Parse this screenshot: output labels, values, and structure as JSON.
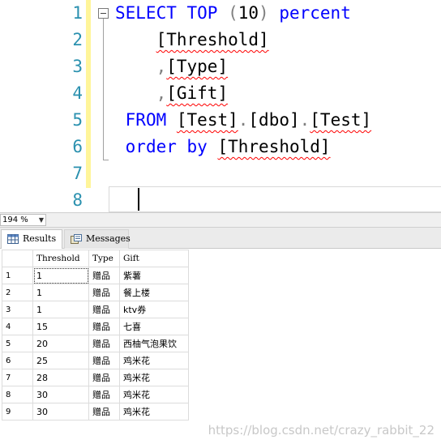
{
  "editor": {
    "line_numbers": [
      "1",
      "2",
      "3",
      "4",
      "5",
      "6",
      "7",
      "8"
    ],
    "lines": [
      [
        {
          "t": "SELECT",
          "c": "kw"
        },
        {
          "t": " ",
          "c": "tx"
        },
        {
          "t": "TOP",
          "c": "kw"
        },
        {
          "t": " (",
          "c": "gr"
        },
        {
          "t": "10",
          "c": "tx"
        },
        {
          "t": ") ",
          "c": "gr"
        },
        {
          "t": "percent",
          "c": "kw"
        }
      ],
      [
        {
          "t": "    ",
          "c": "tx"
        },
        {
          "t": "[Threshold]",
          "c": "tx sq"
        }
      ],
      [
        {
          "t": "    ",
          "c": "tx"
        },
        {
          "t": ",",
          "c": "gr"
        },
        {
          "t": "[Type]",
          "c": "tx sq"
        }
      ],
      [
        {
          "t": "    ",
          "c": "tx"
        },
        {
          "t": ",",
          "c": "gr"
        },
        {
          "t": "[Gift]",
          "c": "tx sq"
        }
      ],
      [
        {
          "t": " ",
          "c": "tx"
        },
        {
          "t": "FROM",
          "c": "kw"
        },
        {
          "t": " ",
          "c": "tx"
        },
        {
          "t": "[Test]",
          "c": "tx sq"
        },
        {
          "t": ".",
          "c": "gr"
        },
        {
          "t": "[dbo]",
          "c": "tx"
        },
        {
          "t": ".",
          "c": "gr"
        },
        {
          "t": "[Test]",
          "c": "tx sq"
        }
      ],
      [
        {
          "t": " ",
          "c": "tx"
        },
        {
          "t": "order",
          "c": "kw"
        },
        {
          "t": " ",
          "c": "tx"
        },
        {
          "t": "by",
          "c": "kw"
        },
        {
          "t": " ",
          "c": "tx"
        },
        {
          "t": "[Threshold]",
          "c": "tx sq"
        }
      ],
      [],
      []
    ]
  },
  "zoom": {
    "value": "194 %"
  },
  "tabs": [
    {
      "label": "Results",
      "icon": "grid-icon",
      "active": true
    },
    {
      "label": "Messages",
      "icon": "messages-icon",
      "active": false
    }
  ],
  "grid": {
    "columns": [
      "Threshold",
      "Type",
      "Gift"
    ],
    "rows": [
      [
        "1",
        "1",
        "赠品",
        "紫薯"
      ],
      [
        "2",
        "1",
        "赠品",
        "餐上楼"
      ],
      [
        "3",
        "1",
        "赠品",
        "ktv券"
      ],
      [
        "4",
        "15",
        "赠品",
        "七喜"
      ],
      [
        "5",
        "20",
        "赠品",
        "西柚气泡果饮"
      ],
      [
        "6",
        "25",
        "赠品",
        "鸡米花"
      ],
      [
        "7",
        "28",
        "赠品",
        "鸡米花"
      ],
      [
        "8",
        "30",
        "赠品",
        "鸡米花"
      ],
      [
        "9",
        "30",
        "赠品",
        "鸡米花"
      ]
    ]
  },
  "watermark": "https://blog.csdn.net/crazy_rabbit_22"
}
